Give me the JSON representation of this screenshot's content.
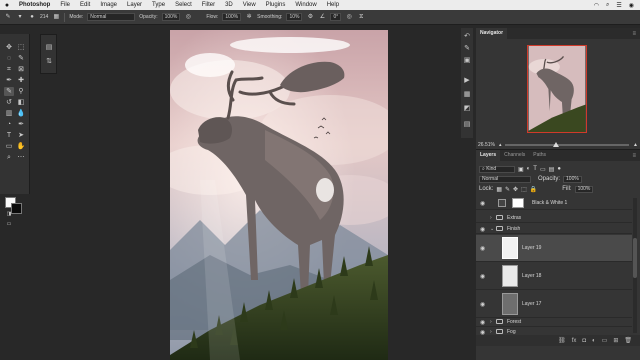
{
  "menubar": {
    "apple": "",
    "items": [
      "Photoshop",
      "File",
      "Edit",
      "Image",
      "Layer",
      "Type",
      "Select",
      "Filter",
      "3D",
      "View",
      "Plugins",
      "Window",
      "Help"
    ],
    "status_icons": [
      "wifi-icon",
      "search-icon",
      "control-center-icon",
      "siri-icon"
    ]
  },
  "options": {
    "brush_size": "214",
    "mode_label": "Mode:",
    "mode_value": "Normal",
    "opacity_label": "Opacity:",
    "opacity_value": "100%",
    "flow_label": "Flow:",
    "flow_value": "100%",
    "smoothing_label": "Smoothing:",
    "smoothing_value": "10%",
    "angle_value": "0°"
  },
  "navigator": {
    "tabs": [
      "Navigator"
    ],
    "zoom": "26.51%"
  },
  "layers_panel": {
    "tabs": [
      "Layers",
      "Channels",
      "Paths"
    ],
    "filter_label": "Kind",
    "blend_mode": "Normal",
    "opacity_label": "Opacity:",
    "opacity_value": "100%",
    "lock_label": "Lock:",
    "fill_label": "Fill:",
    "fill_value": "100%",
    "layers": [
      {
        "name": "Black & White 1",
        "type": "adjustment"
      },
      {
        "name": "Extras",
        "type": "group"
      },
      {
        "name": "Finish",
        "type": "group-open"
      },
      {
        "name": "Layer 19",
        "type": "layer",
        "selected": true
      },
      {
        "name": "Layer 18",
        "type": "layer"
      },
      {
        "name": "Layer 17",
        "type": "layer"
      },
      {
        "name": "Forest",
        "type": "group"
      },
      {
        "name": "Fog",
        "type": "group"
      }
    ],
    "footer_icons": [
      "link-icon",
      "fx-icon",
      "mask-icon",
      "adjustment-icon",
      "folder-icon",
      "new-layer-icon",
      "trash-icon"
    ]
  },
  "colors": {
    "accent": "#d03a2a",
    "foreground": "#fafafa",
    "background": "#0a0a0a"
  }
}
